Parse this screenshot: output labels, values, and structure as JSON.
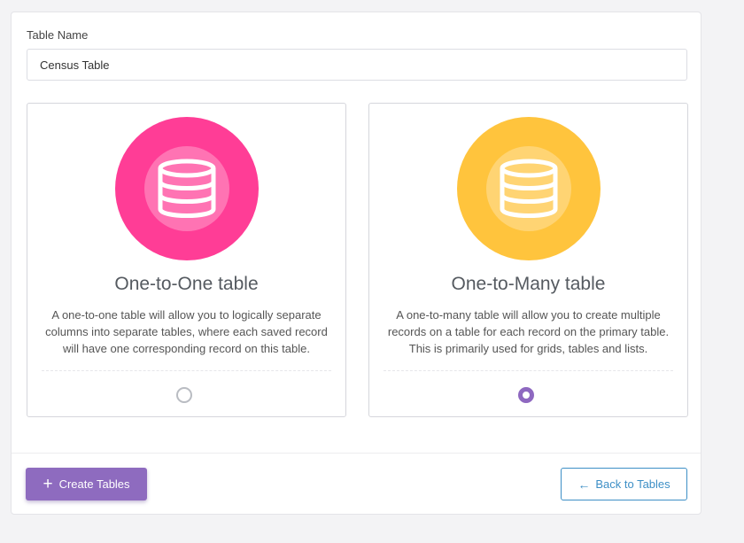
{
  "form": {
    "table_name_label": "Table Name",
    "table_name_value": "Census Table"
  },
  "options": [
    {
      "title": "One-to-One table",
      "description": "A one-to-one table will allow you to logically separate columns into separate tables, where each saved record will have one corresponding record on this table.",
      "icon": "database-icon",
      "color": "#ff3d96",
      "selected": false
    },
    {
      "title": "One-to-Many table",
      "description": "A one-to-many table will allow you to create multiple records on a table for each record on the primary table. This is primarily used for grids, tables and lists.",
      "icon": "database-icon",
      "color": "#ffc43d",
      "selected": true
    }
  ],
  "actions": {
    "create_label": "Create Tables",
    "create_icon": "plus-icon",
    "back_label": "Back to Tables",
    "back_icon": "arrow-left-icon"
  },
  "colors": {
    "primary": "#8e6bbf",
    "link": "#3d8fc6"
  }
}
